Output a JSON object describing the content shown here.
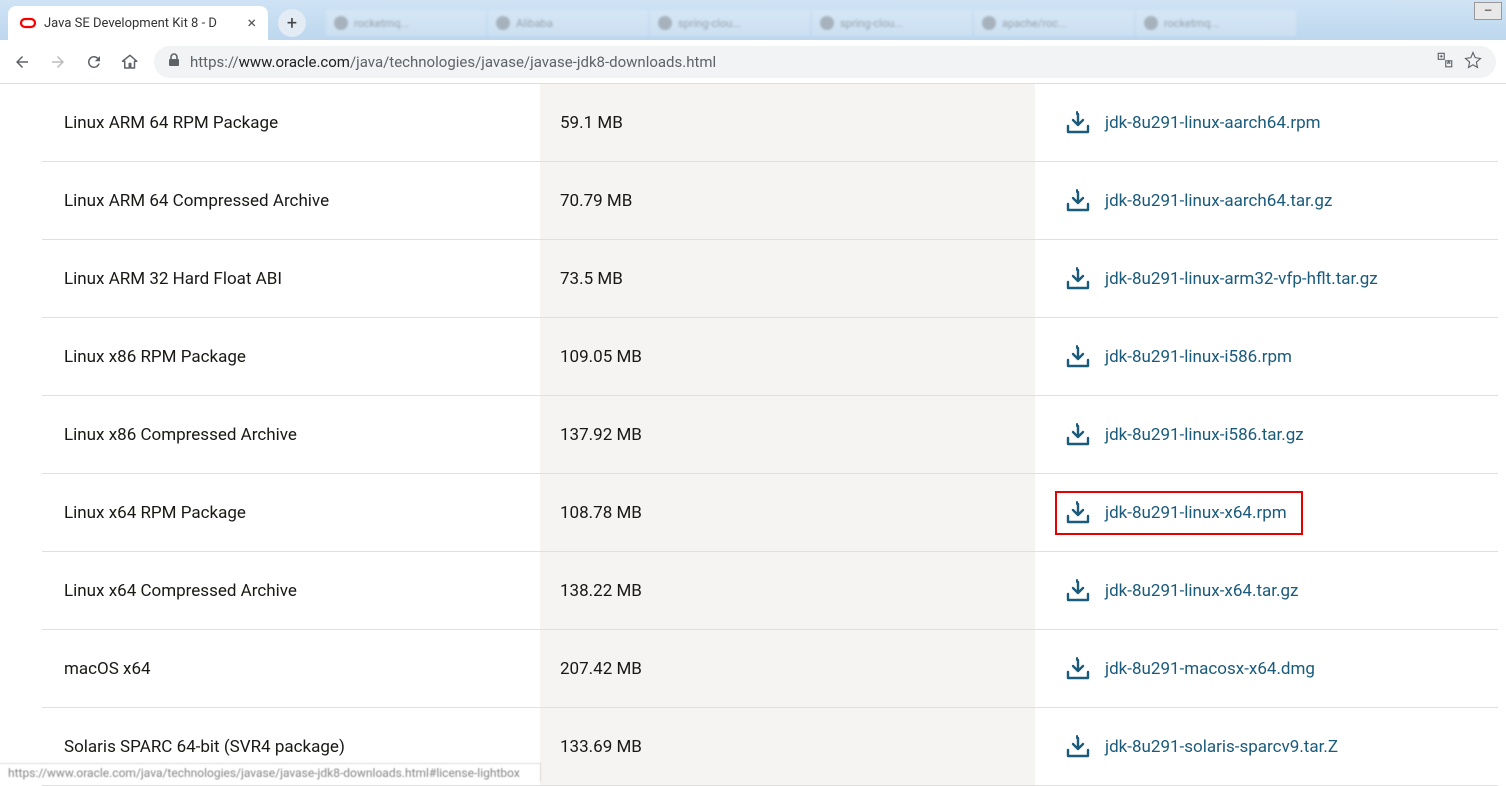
{
  "browser": {
    "active_tab_title": "Java SE Development Kit 8 - D",
    "url_display": "https://www.oracle.com/java/technologies/javase/javase-jdk8-downloads.html",
    "url_host": "www.oracle.com",
    "url_path": "/java/technologies/javase/javase-jdk8-downloads.html",
    "bg_tabs": [
      "rocketmq...",
      "Alibaba",
      "spring-clou...",
      "spring-clou...",
      "apache/roc...",
      "rocketmq..."
    ]
  },
  "rows": [
    {
      "product": "Linux ARM 64 RPM Package",
      "size": "59.1 MB",
      "file": "jdk-8u291-linux-aarch64.rpm",
      "highlight": false
    },
    {
      "product": "Linux ARM 64 Compressed Archive",
      "size": "70.79 MB",
      "file": "jdk-8u291-linux-aarch64.tar.gz",
      "highlight": false
    },
    {
      "product": "Linux ARM 32 Hard Float ABI",
      "size": "73.5 MB",
      "file": "jdk-8u291-linux-arm32-vfp-hflt.tar.gz",
      "highlight": false
    },
    {
      "product": "Linux x86 RPM Package",
      "size": "109.05 MB",
      "file": "jdk-8u291-linux-i586.rpm",
      "highlight": false
    },
    {
      "product": "Linux x86 Compressed Archive",
      "size": "137.92 MB",
      "file": "jdk-8u291-linux-i586.tar.gz",
      "highlight": false
    },
    {
      "product": "Linux x64 RPM Package",
      "size": "108.78 MB",
      "file": "jdk-8u291-linux-x64.rpm",
      "highlight": true
    },
    {
      "product": "Linux x64 Compressed Archive",
      "size": "138.22 MB",
      "file": "jdk-8u291-linux-x64.tar.gz",
      "highlight": false
    },
    {
      "product": "macOS x64",
      "size": "207.42 MB",
      "file": "jdk-8u291-macosx-x64.dmg",
      "highlight": false
    },
    {
      "product": "Solaris SPARC 64-bit (SVR4 package)",
      "size": "133.69 MB",
      "file": "jdk-8u291-solaris-sparcv9.tar.Z",
      "highlight": false
    }
  ],
  "colors": {
    "link": "#1a5a7a",
    "highlight": "#e60000"
  }
}
